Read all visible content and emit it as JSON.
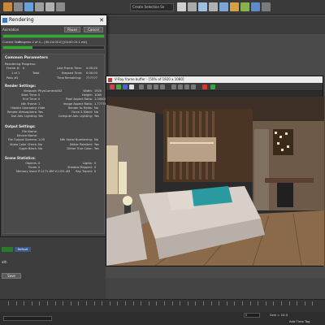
{
  "toolbar": {
    "selection_set": "Create Selection Se",
    "icon_colors": [
      "#c88a3a",
      "#8a8a8a",
      "#6aa0d8",
      "#9e9e9e",
      "#b0b0b0",
      "#8a8a8a",
      "#d0d0d0",
      "#aaaaaa",
      "#9cc0e0",
      "#b0b0b0",
      "#7aa5d6",
      "#d4a040",
      "#8ab04a",
      "#5a8ad0",
      "#7a7a7a"
    ]
  },
  "dialog": {
    "title": "Rendering",
    "close": "✕",
    "animation_label": "Animation",
    "pause_label": "Pause",
    "cancel_label": "Cancel",
    "current_task_label": "Current Task:",
    "current_task_value": "Progress 2 of 4... [00:24:00.0] [00:00:15.1 est]",
    "progress": 0.29,
    "accent": "#27b327",
    "common_params": {
      "title": "Common Parameters",
      "rendering_progress": "Rendering Progress:",
      "frame_label": "Frame #:",
      "frame_value": "0",
      "last_frame_time_label": "Last Frame Time:",
      "last_frame_time_value": "0:00:00",
      "of_label": "1 of 1",
      "total_label": "Total",
      "elapsed_time_label": "Elapsed Time:",
      "elapsed_time_value": "0:00:00",
      "pass_label": "Pass #:",
      "pass_value": "1",
      "time_remaining_label": "Time Remaining:",
      "time_remaining_value": "??:??:??"
    },
    "render_settings": {
      "title": "Render Settings:",
      "rows": [
        {
          "k": "Viewport:",
          "v": "PhysCamera002",
          "k2": "Width:",
          "v2": "1920"
        },
        {
          "k": "Start Time:",
          "v": "0",
          "k2": "Height:",
          "v2": "1080"
        },
        {
          "k": "End Time:",
          "v": "0",
          "k2": "Pixel Aspect Ratio:",
          "v2": "1.00000"
        },
        {
          "k": "Nth Frame:",
          "v": "1",
          "k2": "Image Aspect Ratio:",
          "v2": "1.77778"
        },
        {
          "k": "Hidden Geometry:",
          "v": "Hide",
          "k2": "Render to Fields:",
          "v2": "No"
        },
        {
          "k": "Render Atmosphere:",
          "v": "Yes",
          "k2": "Force 2-Sided:",
          "v2": "No"
        },
        {
          "k": "Use Adv. Lighting:",
          "v": "Yes",
          "k2": "Compute Adv. Lighting:",
          "v2": "Yes"
        }
      ]
    },
    "output_settings": {
      "title": "Output Settings:",
      "rows": [
        {
          "k": "File Name:",
          "v": "",
          "k2": "",
          "v2": ""
        },
        {
          "k": "Device Name:",
          "v": "",
          "k2": "",
          "v2": ""
        },
        {
          "k": "File Output Gamma:",
          "v": "1.00",
          "k2": "Nth Serial Numbering:",
          "v2": "No"
        },
        {
          "k": "Video Color Check:",
          "v": "No",
          "k2": "Dither Paletted:",
          "v2": "Yes"
        },
        {
          "k": "Super Black:",
          "v": "No",
          "k2": "Dither True Color:",
          "v2": "Yes"
        }
      ]
    },
    "scene_stats": {
      "title": "Scene Statistics:",
      "rows": [
        {
          "k": "Objects:",
          "v": "0",
          "k2": "Lights:",
          "v2": "0"
        },
        {
          "k": "Faces:",
          "v": "0",
          "k2": "Shadow Mapped:",
          "v2": "0"
        },
        {
          "k": "Memory Used:",
          "v": "P:1171.8M V:1151.4M",
          "k2": "Ray Traced:",
          "v2": "0"
        }
      ]
    }
  },
  "framebuffer": {
    "title": "V-Ray frame buffer - [50% of 1920 x 1080]"
  },
  "left_panel": {
    "tag1": "Default",
    "tag2": "ath",
    "save_label": "Save"
  },
  "status": {
    "grid_label": "Grid = 10.0",
    "add_time_tag": "Add Time Tag",
    "frame_field": "0"
  }
}
